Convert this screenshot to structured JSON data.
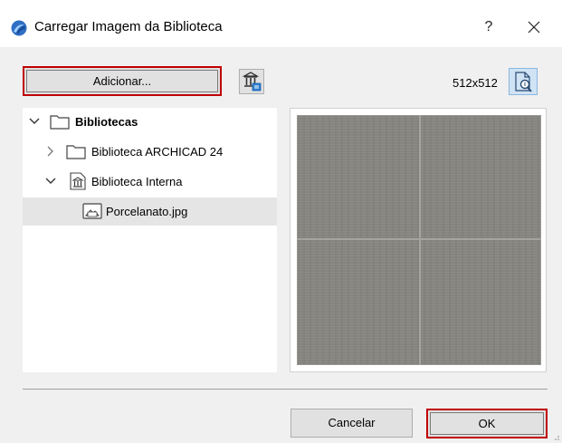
{
  "window": {
    "title": "Carregar Imagem da Biblioteca",
    "help_label": "?",
    "app_icon": "archicad-logo-icon",
    "close_icon": "close-icon"
  },
  "toolbar": {
    "add_label": "Adicionar...",
    "library_manager_icon": "library-manager-icon",
    "resolution": "512x512",
    "zoom_icon": "zoom-preview-icon"
  },
  "tree": {
    "items": [
      {
        "label": "Bibliotecas",
        "expanded": true,
        "bold": true,
        "icon": "folder-icon"
      },
      {
        "label": "Biblioteca ARCHICAD 24",
        "expanded": false,
        "bold": false,
        "icon": "folder-icon"
      },
      {
        "label": "Biblioteca Interna",
        "expanded": true,
        "bold": false,
        "icon": "embedded-library-icon"
      },
      {
        "label": "Porcelanato.jpg",
        "selected": true,
        "bold": false,
        "icon": "image-file-icon"
      }
    ]
  },
  "preview": {
    "texture_color": "#878580",
    "grout_color": "#a6a4a0"
  },
  "footer": {
    "cancel_label": "Cancelar",
    "ok_label": "OK"
  },
  "colors": {
    "highlight_border": "#c00000",
    "selected_row": "#e5e5e5",
    "zoom_button_bg": "#cfe3f5"
  }
}
